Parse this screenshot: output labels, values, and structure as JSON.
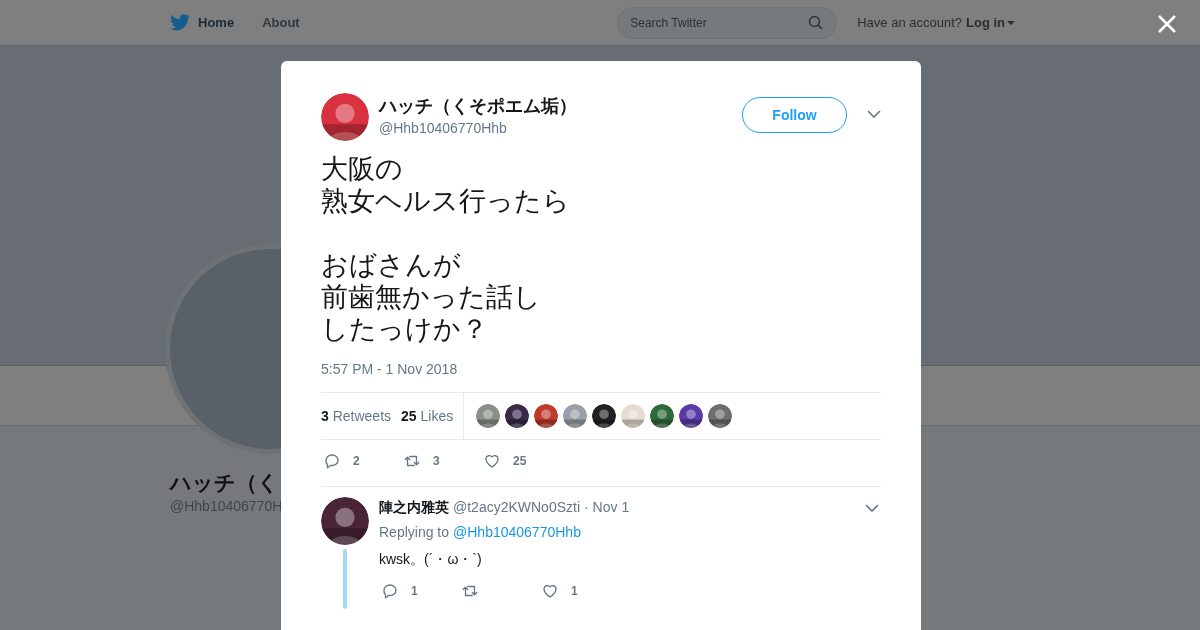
{
  "header": {
    "nav": [
      {
        "label": "Home",
        "selected": true
      },
      {
        "label": "About",
        "selected": false
      }
    ],
    "search": {
      "placeholder": "Search Twitter"
    },
    "account_prompt": "Have an account?",
    "login": "Log in"
  },
  "profile_behind": {
    "name": "ハッチ（く",
    "handle": "@Hhb10406770H"
  },
  "tweet": {
    "author": {
      "name": "ハッチ（くそポエム垢）",
      "handle": "@Hhb10406770Hhb"
    },
    "follow": "Follow",
    "paragraphs": [
      [
        "大阪の",
        "熟女ヘルス行ったら"
      ],
      [
        "おばさんが",
        "前歯無かった話し",
        "したっけか？"
      ]
    ],
    "time": "5:57 PM - 1 Nov 2018",
    "stats": [
      {
        "count": "3",
        "label": "Retweets"
      },
      {
        "count": "25",
        "label": "Likes"
      }
    ],
    "likers": [
      {
        "color": "#8a8f88"
      },
      {
        "color": "#3a2a4a"
      },
      {
        "color": "#c0392b"
      },
      {
        "color": "#9aa0a8"
      },
      {
        "color": "#222222"
      },
      {
        "color": "#e6ddd2"
      },
      {
        "color": "#2f6b3a"
      },
      {
        "color": "#5b3aa8"
      },
      {
        "color": "#6e6e6e"
      }
    ],
    "actions": [
      {
        "kind": "reply",
        "count": "2"
      },
      {
        "kind": "retweet",
        "count": "3"
      },
      {
        "kind": "like",
        "count": "25"
      }
    ]
  },
  "replies": [
    {
      "name": "陣之内雅英",
      "handle": "@t2acy2KWNo0Szti",
      "date": "· Nov 1",
      "replying_label": "Replying to",
      "replying_to": "@Hhb10406770Hhb",
      "text": "kwsk。(´・ω・`)",
      "actions": [
        {
          "kind": "reply",
          "count": "1"
        },
        {
          "kind": "retweet"
        },
        {
          "kind": "like",
          "count": "1"
        }
      ]
    }
  ]
}
